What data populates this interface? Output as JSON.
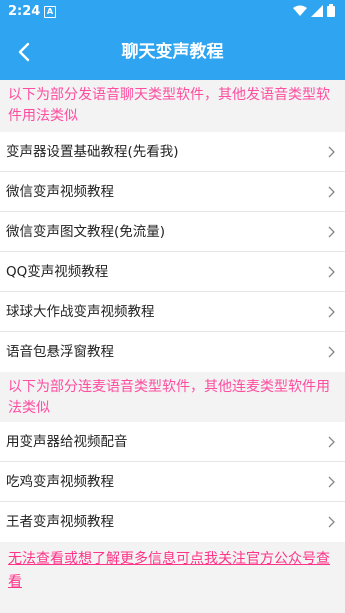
{
  "status_bar": {
    "time": "2:24",
    "notification_icon": "a-icon",
    "wifi_icon": "wifi-icon",
    "signal_icon": "signal-icon",
    "battery_icon": "battery-icon"
  },
  "header": {
    "title": "聊天变声教程",
    "back_icon": "chevron-left-icon"
  },
  "section1": {
    "heading": "以下为部分发语音聊天类型软件，其他发语音类型软件用法类似",
    "items": [
      {
        "label": "变声器设置基础教程(先看我)"
      },
      {
        "label": "微信变声视频教程"
      },
      {
        "label": "微信变声图文教程(免流量)"
      },
      {
        "label": "QQ变声视频教程"
      },
      {
        "label": "球球大作战变声视频教程"
      },
      {
        "label": "语音包悬浮窗教程"
      }
    ]
  },
  "section2": {
    "heading": "以下为部分连麦语音类型软件，其他连麦类型软件用法类似",
    "items": [
      {
        "label": "用变声器给视频配音"
      },
      {
        "label": "吃鸡变声视频教程"
      },
      {
        "label": "王者变声视频教程"
      }
    ]
  },
  "footer": {
    "link_text": "无法查看或想了解更多信息可点我关注官方公众号查看"
  },
  "colors": {
    "header_bg": "#2fa4f1",
    "heading_text": "#ff4da0",
    "footer_link": "#ff3388"
  }
}
